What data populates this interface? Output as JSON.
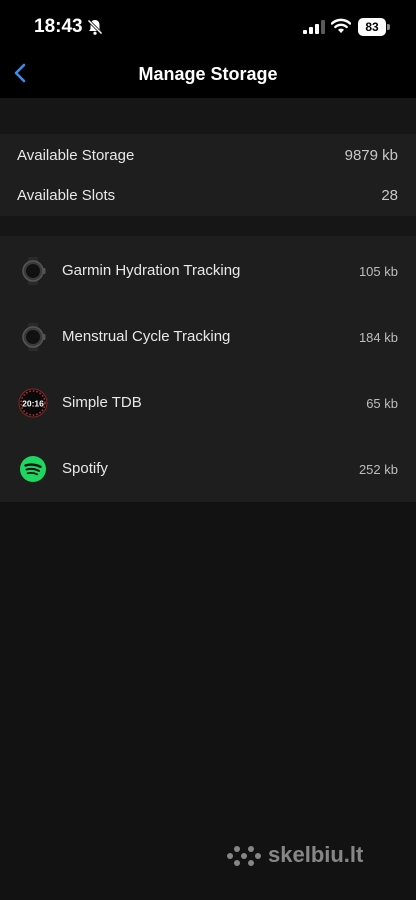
{
  "status_bar": {
    "time": "18:43",
    "battery": "83",
    "icons": [
      "bell-slash-icon",
      "signal-icon",
      "wifi-icon",
      "battery-icon"
    ]
  },
  "nav": {
    "back_icon": "chevron-left-icon",
    "title": "Manage Storage"
  },
  "storage": {
    "rows": [
      {
        "label": "Available Storage",
        "value": "9879 kb"
      },
      {
        "label": "Available Slots",
        "value": "28"
      }
    ]
  },
  "apps": [
    {
      "name": "Garmin Hydration Tracking",
      "size": "105 kb",
      "icon": "watch-icon"
    },
    {
      "name": "Menstrual Cycle Tracking",
      "size": "184 kb",
      "icon": "watch-icon"
    },
    {
      "name": "Simple TDB",
      "size": "65 kb",
      "icon": "watch-face-icon",
      "icon_text": "20:16"
    },
    {
      "name": "Spotify",
      "size": "252 kb",
      "icon": "spotify-icon"
    }
  ],
  "watermark": {
    "text": "skelbiu.lt"
  },
  "colors": {
    "accent": "#3f8ce8",
    "background": "#121212",
    "card": "#1e1e1e",
    "spotify_green": "#1ed760"
  }
}
